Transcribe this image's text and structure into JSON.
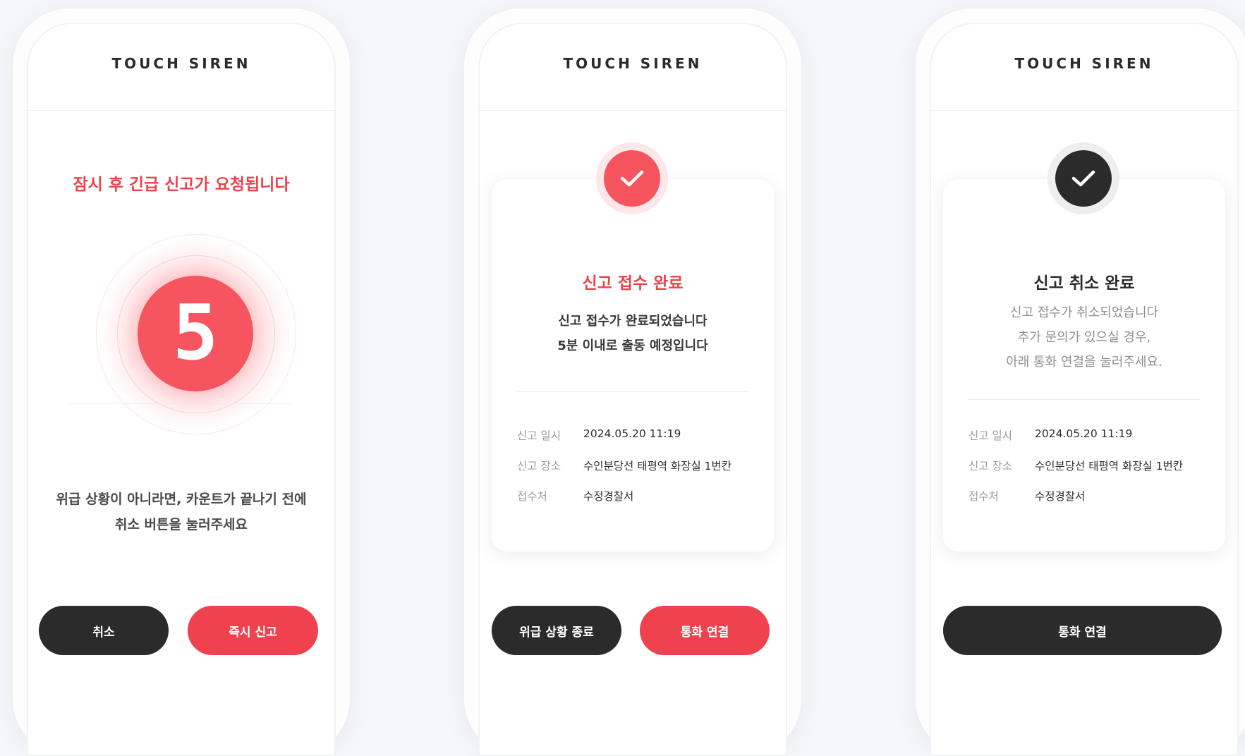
{
  "brand": "TOUCH SIREN",
  "colors": {
    "accent_red": "#f0414d",
    "dark": "#2b2b2c",
    "background": "#f5f6fb"
  },
  "screen1": {
    "title": "잠시 후 긴급 신고가 요청됩니다",
    "countdown": "5",
    "note_line1": "위급 상황이 아니라면, 카운트가 끝나기 전에",
    "note_line2": "취소 버튼을 눌러주세요",
    "cancel_button": "취소",
    "report_button": "즉시 신고"
  },
  "screen2": {
    "status_icon": "check-icon",
    "title": "신고 접수 완료",
    "msg_line1": "신고 접수가 완료되었습니다",
    "msg_line2": "5분 이내로 출동 예정입니다",
    "info": [
      {
        "label": "신고 일시",
        "value": "2024.05.20 11:19"
      },
      {
        "label": "신고 장소",
        "value": "수인분당선 태평역 화장실 1번칸"
      },
      {
        "label": "접수처",
        "value": "수정경찰서"
      }
    ],
    "end_button": "위급 상황 종료",
    "call_button": "통화 연결"
  },
  "screen3": {
    "status_icon": "check-icon",
    "title": "신고 취소 완료",
    "msg_line1": "신고 접수가 취소되었습니다",
    "msg_line2": "추가 문의가 있으실 경우,",
    "msg_line3": "아래 통화 연결을 눌러주세요.",
    "info": [
      {
        "label": "신고 일시",
        "value": "2024.05.20 11:19"
      },
      {
        "label": "신고 장소",
        "value": "수인분당선 태평역 화장실 1번칸"
      },
      {
        "label": "접수처",
        "value": "수정경찰서"
      }
    ],
    "call_button": "통화 연결"
  }
}
